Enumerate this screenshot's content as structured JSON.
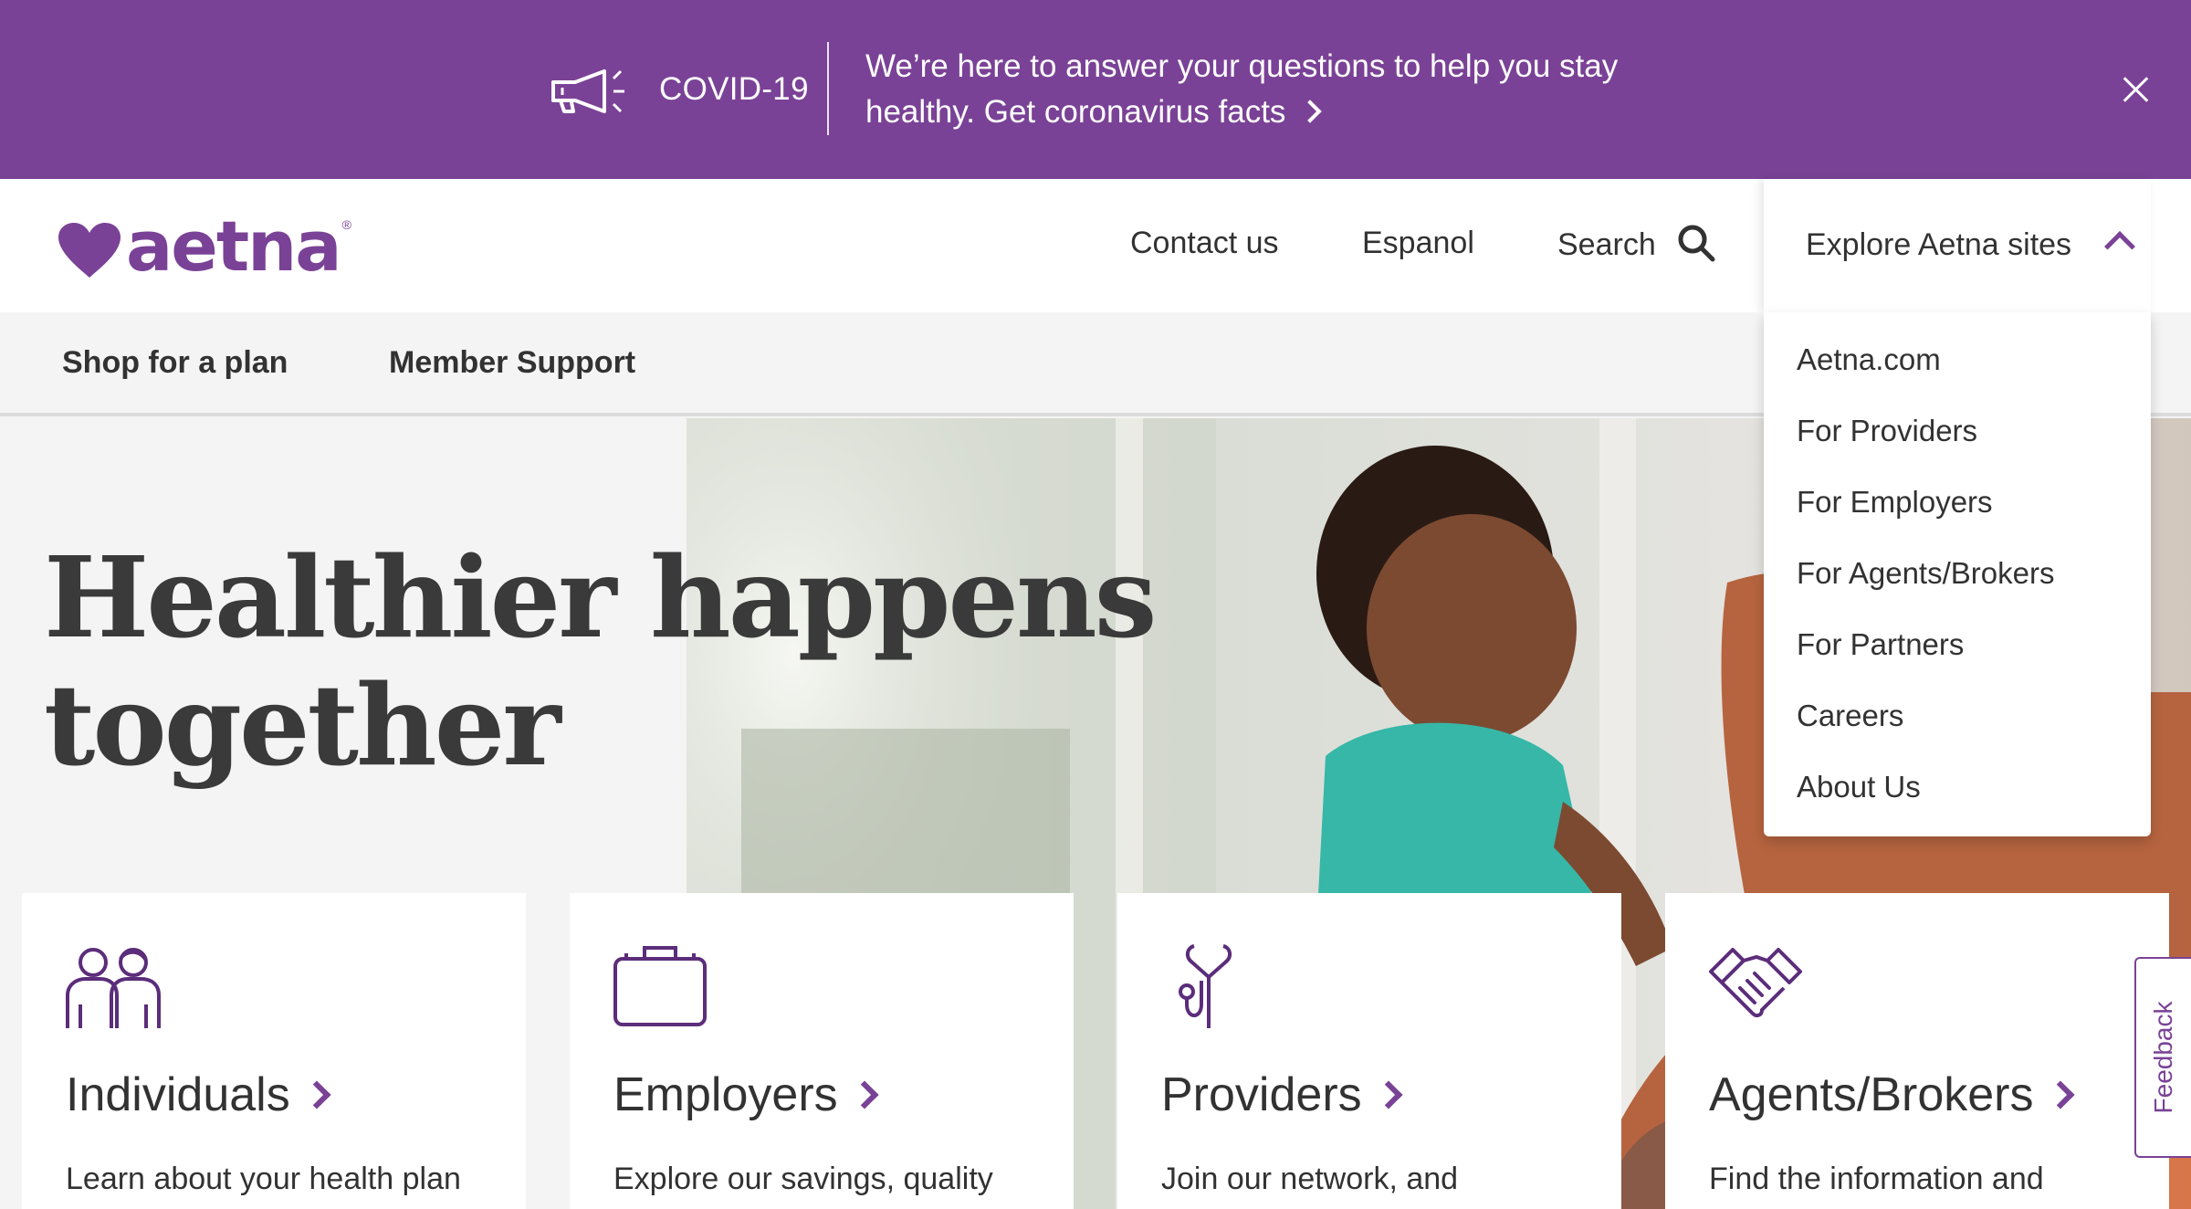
{
  "colors": {
    "brand_purple": "#7a4296",
    "text_dark": "#323232",
    "page_bg": "#f4f4f4"
  },
  "banner": {
    "icon": "megaphone-icon",
    "tag": "COVID-19",
    "message": "We’re here to answer your questions to help you stay healthy.",
    "link": "Get coronavirus facts",
    "close_icon": "close-icon"
  },
  "header": {
    "logo_text": "aetna",
    "logo_reg": "®",
    "nav": {
      "contact": "Contact us",
      "espanol": "Espanol",
      "search": "Search"
    },
    "search_icon": "search-icon",
    "explore": {
      "label": "Explore Aetna sites",
      "chevron": "chevron-up-icon"
    }
  },
  "subnav": {
    "items": [
      "Shop for a plan",
      "Member Support"
    ]
  },
  "dropdown": {
    "items": [
      "Aetna.com",
      "For Providers",
      "For Employers",
      "For Agents/Brokers",
      "For Partners",
      "Careers",
      "About Us"
    ]
  },
  "hero": {
    "title_line1": "Healthier happens",
    "title_line2": "together"
  },
  "cards": [
    {
      "icon": "people-icon",
      "title": "Individuals",
      "desc": "Learn about your health plan"
    },
    {
      "icon": "briefcase-icon",
      "title": "Employers",
      "desc": "Explore our savings, quality"
    },
    {
      "icon": "stethoscope-icon",
      "title": "Providers",
      "desc": "Join our network, and"
    },
    {
      "icon": "handshake-icon",
      "title": "Agents/Brokers",
      "desc": "Find the information and"
    }
  ],
  "feedback": {
    "label": "Feedback"
  }
}
